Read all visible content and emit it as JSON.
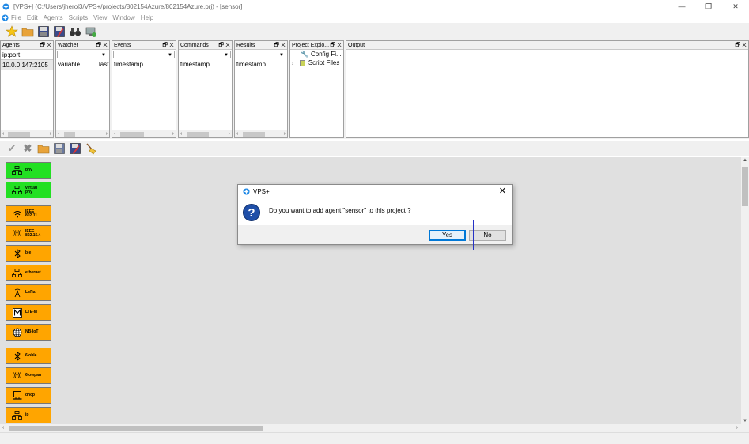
{
  "window": {
    "title": "[VPS+] (C:/Users/jherol3/VPS+/projects/802154Azure/802154Azure.prj) - [sensor]",
    "controls": [
      "—",
      "❐",
      "✕"
    ]
  },
  "menu": {
    "items": [
      {
        "label": "File",
        "underline": "F",
        "rest": "ile"
      },
      {
        "label": "Edit",
        "underline": "E",
        "rest": "dit"
      },
      {
        "label": "Agents",
        "underline": "A",
        "rest": "gents"
      },
      {
        "label": "Scripts",
        "underline": "S",
        "rest": "cripts"
      },
      {
        "label": "View",
        "underline": "V",
        "rest": "iew"
      },
      {
        "label": "Window",
        "underline": "W",
        "rest": "indow"
      },
      {
        "label": "Help",
        "underline": "H",
        "rest": "elp"
      }
    ]
  },
  "panels": {
    "agents": {
      "title": "Agents",
      "header_col": "ip:port",
      "row": "10.0.0.147:2105"
    },
    "watcher": {
      "title": "Watcher",
      "col1": "variable",
      "col2": "last"
    },
    "events": {
      "title": "Events",
      "col1": "timestamp"
    },
    "commands": {
      "title": "Commands",
      "col1": "timestamp"
    },
    "results": {
      "title": "Results",
      "col1": "timestamp"
    },
    "project_explorer": {
      "title": "Project Explo...",
      "item1": "Config Fi...",
      "item2": "Script Files"
    },
    "output": {
      "title": "Output"
    }
  },
  "panel_buttons": "🗗 ✕",
  "palette": [
    {
      "label1": "phy",
      "label2": "",
      "color": "green",
      "icon": "network-icon"
    },
    {
      "label1": "virtual",
      "label2": "phy",
      "color": "green",
      "icon": "network-icon"
    },
    {
      "label1": "IEEE",
      "label2": "802.11",
      "color": "orange",
      "icon": "wifi-icon"
    },
    {
      "label1": "IEEE",
      "label2": "802.15.4",
      "color": "orange",
      "icon": "radio-icon"
    },
    {
      "label1": "ble",
      "label2": "",
      "color": "orange",
      "icon": "bluetooth-icon"
    },
    {
      "label1": "ethernet",
      "label2": "",
      "color": "orange",
      "icon": "network-icon"
    },
    {
      "label1": "LoRa",
      "label2": "",
      "color": "orange",
      "icon": "antenna-icon"
    },
    {
      "label1": "LTE-M",
      "label2": "",
      "color": "orange",
      "icon": "m-icon"
    },
    {
      "label1": "NB-IoT",
      "label2": "",
      "color": "orange",
      "icon": "globe-icon"
    },
    {
      "label1": "6loble",
      "label2": "",
      "color": "orange",
      "icon": "bluetooth-icon"
    },
    {
      "label1": "6lowpan",
      "label2": "",
      "color": "orange",
      "icon": "radio-icon"
    },
    {
      "label1": "dhcp",
      "label2": "",
      "color": "orange",
      "icon": "computer-icon"
    },
    {
      "label1": "ip",
      "label2": "",
      "color": "orange",
      "icon": "network-icon"
    }
  ],
  "dialog": {
    "title": "VPS+",
    "message": "Do you want to add agent \"sensor\" to this project ?",
    "yes_label": "Yes",
    "no_label": "No",
    "close": "✕",
    "icon_glyph": "?"
  },
  "colors": {
    "green": "#22e022",
    "orange": "#ffa500",
    "highlight": "#2632c6",
    "focus": "#0078d7"
  }
}
